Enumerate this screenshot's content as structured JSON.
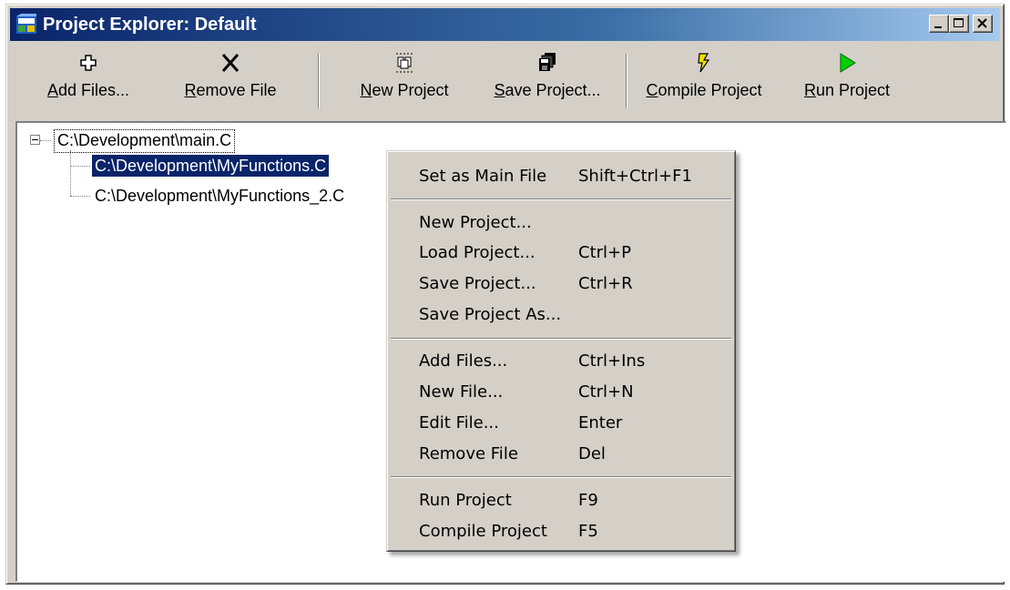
{
  "window": {
    "title": "Project Explorer: Default",
    "title_gradient_start": "#0a246a",
    "title_gradient_end": "#a6caf0",
    "controls": [
      "minimize-icon",
      "maximize-icon",
      "close-icon"
    ]
  },
  "toolbar": {
    "buttons": [
      {
        "pre": "",
        "ul": "A",
        "post": "dd Files...",
        "icon": "add-files-icon"
      },
      {
        "pre": "",
        "ul": "R",
        "post": "emove File",
        "icon": "remove-file-icon"
      },
      {
        "pre": "",
        "ul": "N",
        "post": "ew Project",
        "icon": "new-project-icon"
      },
      {
        "pre": "",
        "ul": "S",
        "post": "ave Project...",
        "icon": "save-project-icon"
      },
      {
        "pre": "",
        "ul": "C",
        "post": "ompile Project",
        "icon": "compile-project-icon"
      },
      {
        "pre": "",
        "ul": "R",
        "post": "un Project",
        "icon": "run-project-icon"
      }
    ]
  },
  "tree": {
    "root": "C:\\Development\\main.C",
    "children": [
      "C:\\Development\\MyFunctions.C",
      "C:\\Development\\MyFunctions_2.C"
    ],
    "selected_index": 0,
    "selection_color": "#0a246a"
  },
  "context_menu": {
    "groups": [
      [
        {
          "label": "Set as Main File",
          "shortcut": "Shift+Ctrl+F1"
        }
      ],
      [
        {
          "label": "New Project...",
          "shortcut": ""
        },
        {
          "label": "Load Project...",
          "shortcut": "Ctrl+P"
        },
        {
          "label": "Save Project...",
          "shortcut": "Ctrl+R"
        },
        {
          "label": "Save Project As...",
          "shortcut": ""
        }
      ],
      [
        {
          "label": "Add Files...",
          "shortcut": "Ctrl+Ins"
        },
        {
          "label": "New File...",
          "shortcut": "Ctrl+N"
        },
        {
          "label": "Edit File...",
          "shortcut": "Enter"
        },
        {
          "label": "Remove File",
          "shortcut": "Del"
        }
      ],
      [
        {
          "label": "Run Project",
          "shortcut": "F9"
        },
        {
          "label": "Compile Project",
          "shortcut": "F5"
        }
      ]
    ]
  }
}
